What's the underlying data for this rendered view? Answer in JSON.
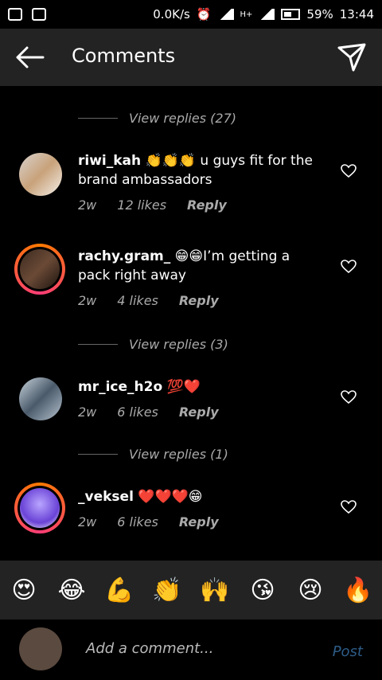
{
  "status_bar": {
    "speed": "0.0K/s",
    "network": "H+",
    "battery": "59%",
    "time": "13:44"
  },
  "header": {
    "title": "Comments"
  },
  "view_replies": [
    {
      "label": "View replies (27)"
    },
    {
      "label": "View replies (3)"
    },
    {
      "label": "View replies (1)"
    }
  ],
  "comments": [
    {
      "username": "riwi_kah",
      "text": " 👏👏👏 u guys fit for the brand ambassadors",
      "time": "2w",
      "likes": "12 likes",
      "reply": "Reply"
    },
    {
      "username": "rachy.gram_",
      "text": " 😁😁I’m getting a pack right away",
      "time": "2w",
      "likes": "4 likes",
      "reply": "Reply"
    },
    {
      "username": "mr_ice_h2o",
      "text": " 💯❤️",
      "time": "2w",
      "likes": "6 likes",
      "reply": "Reply"
    },
    {
      "username": "_veksel",
      "text": " ❤️❤️❤️😁",
      "time": "2w",
      "likes": "6 likes",
      "reply": "Reply"
    }
  ],
  "emoji_bar": [
    "😍",
    "😂",
    "💪",
    "👏",
    "🙌",
    "😘",
    "😢",
    "🔥"
  ],
  "composer": {
    "placeholder": "Add a comment...",
    "post": "Post"
  }
}
